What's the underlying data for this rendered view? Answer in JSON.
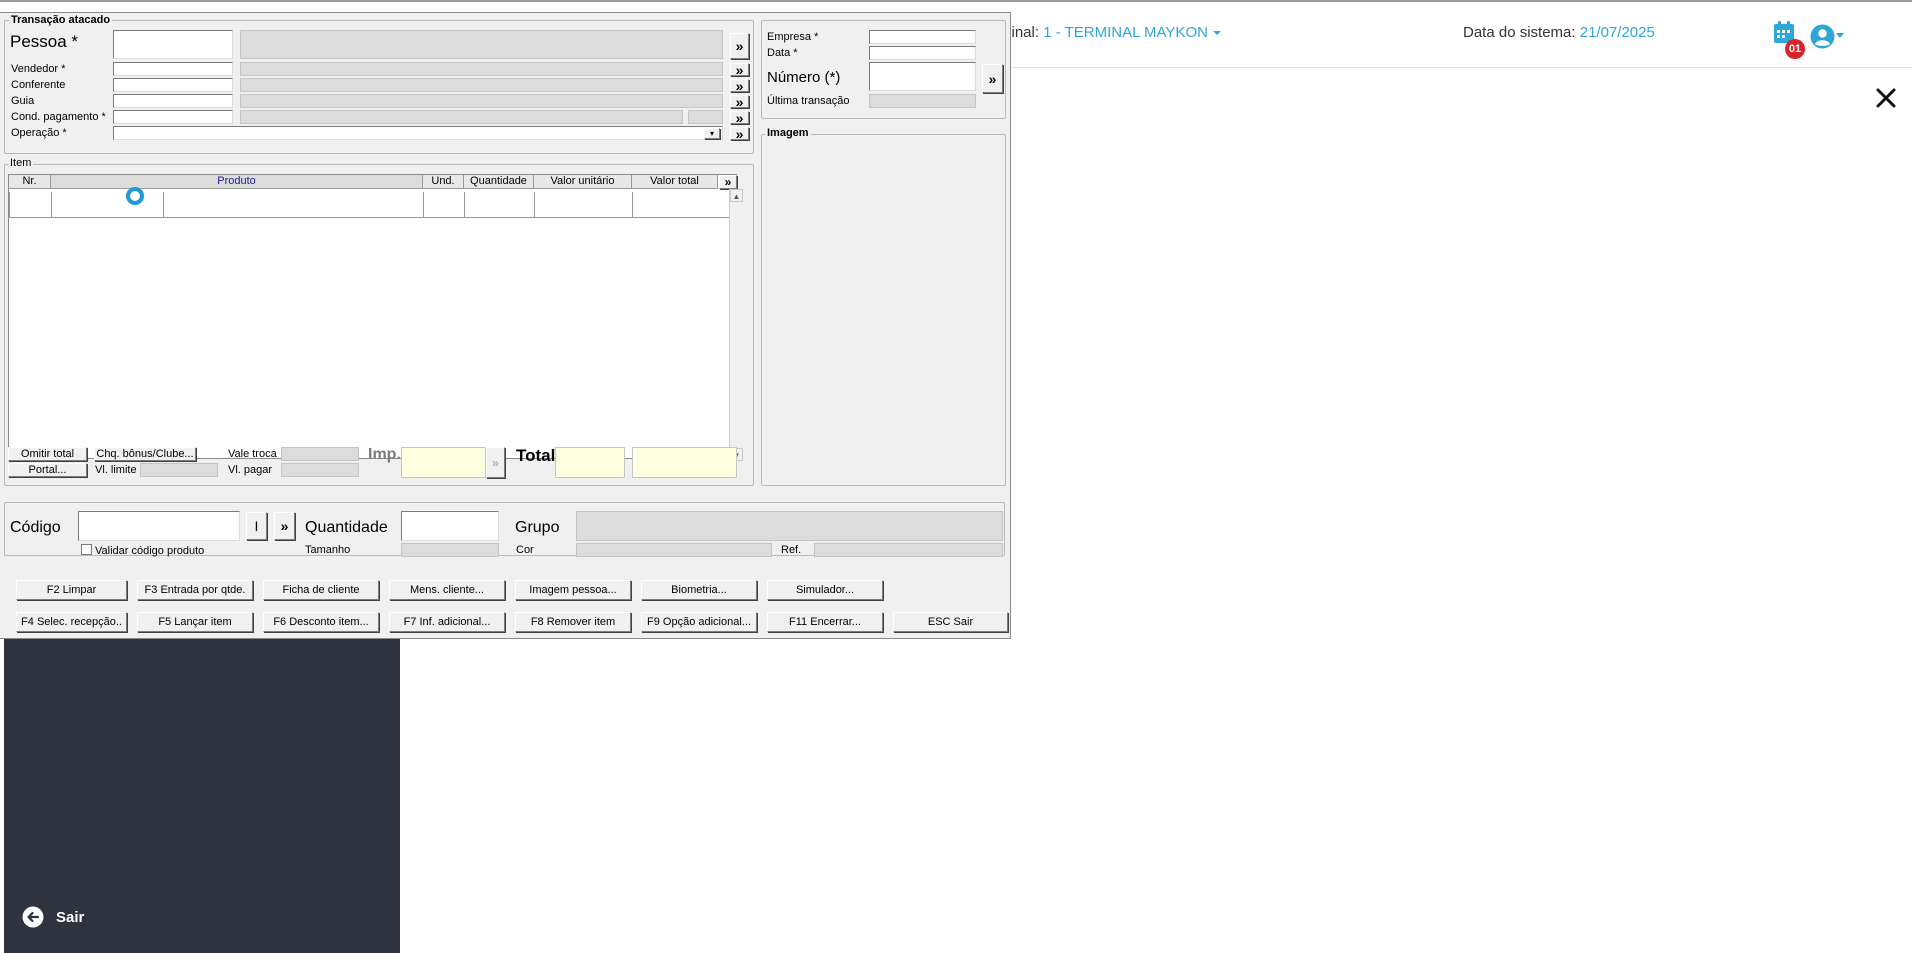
{
  "app": {
    "terminal_label": "rminal:",
    "terminal_value": "1 - TERMINAL MAYKON",
    "date_label": "Data do sistema:",
    "date_value": "21/07/2025",
    "notification_count": "01",
    "sidebar_exit": "Sair"
  },
  "dialog": {
    "header_group": "Transação atacado",
    "pessoa_label": "Pessoa *",
    "vendedor_label": "Vendedor *",
    "conferente_label": "Conferente",
    "guia_label": "Guia",
    "cond_pagamento_label": "Cond. pagamento *",
    "operacao_label": "Operação *",
    "more_symbol": "»",
    "empresa_label": "Empresa *",
    "data_label": "Data *",
    "numero_label": "Número (*)",
    "ultima_transacao_label": "Última transação",
    "imagem_group": "Imagem",
    "item_group": "Item",
    "columns": [
      "Nr.",
      "Produto",
      "Und.",
      "Quantidade",
      "Valor unitário",
      "Valor total"
    ],
    "omitir_total": "Omitir total",
    "chq_bonus": "Chq. bônus/Clube...",
    "portal": "Portal...",
    "vl_limite": "Vl. limite",
    "vale_troca": "Vale troca",
    "vl_pagar": "Vl. pagar",
    "imp_label": "Imp.",
    "total_label": "Total",
    "codigo_label": "Código",
    "codigo_btn": "I",
    "validar_codigo": "Validar código produto",
    "quantidade_label": "Quantidade",
    "tamanho_label": "Tamanho",
    "grupo_label": "Grupo",
    "cor_label": "Cor",
    "ref_label": "Ref.",
    "buttons_row1": [
      "F2 Limpar",
      "F3 Entrada por qtde.",
      "Ficha de cliente",
      "Mens. cliente...",
      "Imagem pessoa...",
      "Biometria...",
      "Simulador..."
    ],
    "buttons_row2": [
      "F4 Selec. recepção..",
      "F5 Lançar item",
      "F6 Desconto item...",
      "F7 Inf. adicional...",
      "F8 Remover item",
      "F9 Opção adicional...",
      "F11 Encerrar...",
      "ESC Sair"
    ]
  }
}
